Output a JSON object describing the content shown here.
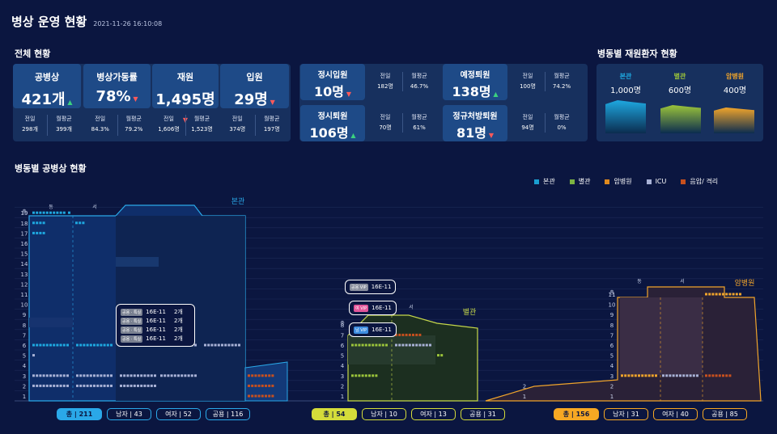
{
  "header": {
    "title": "병상 운영 현황",
    "datetime": "2021-11-26 16:10:08"
  },
  "sections": {
    "overall": "전체 현황",
    "ward_patients": "병동별 재원환자 현황",
    "ward_beds": "병동별 공병상 현황"
  },
  "kpis": [
    {
      "label": "공병상",
      "value": "421개",
      "trend": "up",
      "sub": [
        {
          "k": "전일",
          "v": "298개"
        },
        {
          "k": "월평균",
          "v": "399개"
        }
      ]
    },
    {
      "label": "병상가동률",
      "value": "78%",
      "trend": "down",
      "sub": [
        {
          "k": "전일",
          "v": "84.3%"
        },
        {
          "k": "월평균",
          "v": "79.2%"
        }
      ]
    },
    {
      "label": "재원",
      "value": "1,495명",
      "trend": "down",
      "sub": [
        {
          "k": "전일",
          "v": "1,606명"
        },
        {
          "k": "월평균",
          "v": "1,523명"
        }
      ]
    },
    {
      "label": "입원",
      "value": "29명",
      "trend": "down",
      "sub": [
        {
          "k": "전일",
          "v": "374명"
        },
        {
          "k": "월평균",
          "v": "197명"
        }
      ]
    }
  ],
  "flows": [
    {
      "label": "정시입원",
      "value": "10명",
      "trend": "down",
      "sub": [
        {
          "k": "전일",
          "v": "182명"
        },
        {
          "k": "월평균",
          "v": "46.7%"
        }
      ]
    },
    {
      "label": "예정퇴원",
      "value": "138명",
      "trend": "up",
      "sub": [
        {
          "k": "전일",
          "v": "100명"
        },
        {
          "k": "월평균",
          "v": "74.2%"
        }
      ]
    },
    {
      "label": "정시퇴원",
      "value": "106명",
      "trend": "up",
      "sub": [
        {
          "k": "전일",
          "v": "70명"
        },
        {
          "k": "월평균",
          "v": "61%"
        }
      ]
    },
    {
      "label": "정규처방퇴원",
      "value": "81명",
      "trend": "down",
      "sub": [
        {
          "k": "전일",
          "v": "94명"
        },
        {
          "k": "월평균",
          "v": "0%"
        }
      ]
    }
  ],
  "buildings": [
    {
      "name": "본관",
      "count": "1,000명",
      "color": "#1ea8e0"
    },
    {
      "name": "별관",
      "count": "600명",
      "color": "#9bc43a"
    },
    {
      "name": "암병원",
      "count": "400명",
      "color": "#f0a42b"
    }
  ],
  "legend": [
    {
      "label": "본관",
      "color": "#1a9fd0"
    },
    {
      "label": "별관",
      "color": "#7cb342"
    },
    {
      "label": "암병원",
      "color": "#e08a1e"
    },
    {
      "label": "ICU",
      "color": "#a9b2d6"
    },
    {
      "label": "음압/ 격리",
      "color": "#c8501e"
    }
  ],
  "chart_labels": {
    "main": "본관",
    "annex": "별관",
    "cancer": "암병원",
    "floor_unit": "층",
    "east": "동",
    "west": "서"
  },
  "floors_main": [
    "19",
    "18",
    "17",
    "16",
    "15",
    "14",
    "13",
    "12",
    "11",
    "10",
    "9",
    "8",
    "7",
    "6",
    "5",
    "4",
    "3",
    "2",
    "1"
  ],
  "floors_annex": [
    "8",
    "7",
    "6",
    "5",
    "4",
    "3",
    "2",
    "1"
  ],
  "floors_cancer": [
    "11",
    "10",
    "9",
    "8",
    "7",
    "6",
    "5",
    "4",
    "3",
    "2",
    "1"
  ],
  "tooltip_main": {
    "rows": [
      {
        "tag": "공용 · 특실",
        "room": "16E-11",
        "count": "2개"
      },
      {
        "tag": "공용 · 특실",
        "room": "16E-11",
        "count": "2개"
      },
      {
        "tag": "공용 · 특실",
        "room": "16E-11",
        "count": "2개"
      },
      {
        "tag": "공용 · 특실",
        "room": "16E-11",
        "count": "2개"
      }
    ]
  },
  "tooltip_annex": [
    {
      "tag": "공용 VIP",
      "room": "16E-11",
      "tagcolor": "#8a8f9e"
    },
    {
      "tag": "여 VIP",
      "room": "16E-11",
      "tagcolor": "#e2569a"
    },
    {
      "tag": "남 VIP",
      "room": "16E-11",
      "tagcolor": "#3e8de0"
    }
  ],
  "pills": {
    "main": [
      {
        "k": "총",
        "v": "211"
      },
      {
        "k": "남자",
        "v": "43"
      },
      {
        "k": "여자",
        "v": "52"
      },
      {
        "k": "공용",
        "v": "116"
      }
    ],
    "annex": [
      {
        "k": "총",
        "v": "54"
      },
      {
        "k": "남자",
        "v": "10"
      },
      {
        "k": "여자",
        "v": "13"
      },
      {
        "k": "공용",
        "v": "31"
      }
    ],
    "cancer": [
      {
        "k": "총",
        "v": "156"
      },
      {
        "k": "남자",
        "v": "31"
      },
      {
        "k": "여자",
        "v": "40"
      },
      {
        "k": "공용",
        "v": "85"
      }
    ]
  }
}
